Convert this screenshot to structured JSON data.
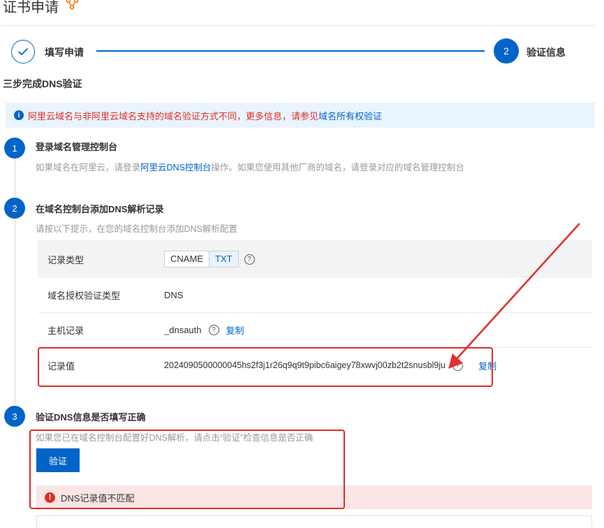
{
  "page": {
    "title": "证书申请"
  },
  "steps": {
    "step1_label": "填写申请",
    "step2_number": "2",
    "step2_label": "验证信息"
  },
  "section": {
    "heading": "三步完成DNS验证"
  },
  "notice": {
    "icon": "i",
    "text": "阿里云域名与非阿里云域名支持的域名验证方式不同，更多信息，请参见",
    "link": "域名所有权验证"
  },
  "step_one": {
    "number": "1",
    "title": "登录域名管理控制台",
    "desc_before": "如果域名在阿里云，请登录",
    "desc_link": "阿里云DNS控制台",
    "desc_after": "操作。如果您使用其他厂商的域名，请登录对应的域名管理控制台"
  },
  "step_two": {
    "number": "2",
    "title": "在域名控制台添加DNS解析记录",
    "desc": "请按以下提示，在您的域名控制台添加DNS解析配置",
    "rows": {
      "record_type": {
        "label": "记录类型",
        "options": [
          "CNAME",
          "TXT"
        ],
        "selected": "TXT"
      },
      "auth_type": {
        "label": "域名授权验证类型",
        "value": "DNS"
      },
      "host": {
        "label": "主机记录",
        "value": "_dnsauth",
        "copy": "复制"
      },
      "record_value": {
        "label": "记录值",
        "value": "2024090500000045hs2f3j1r26q9q9t9pibc6aigey78xwvj00zb2t2snusbl9ju",
        "copy": "复制"
      }
    }
  },
  "step_three": {
    "number": "3",
    "title": "验证DNS信息是否填写正确",
    "desc": "如果您已在域名控制台配置好DNS解析，请点击“验证”检查信息是否正确",
    "button": "验证",
    "error_icon": "!",
    "error": "DNS记录值不匹配"
  },
  "help_glyph": "?",
  "colors": {
    "accent": "#0064c8",
    "error": "#d93026",
    "annotation": "#e03030"
  }
}
